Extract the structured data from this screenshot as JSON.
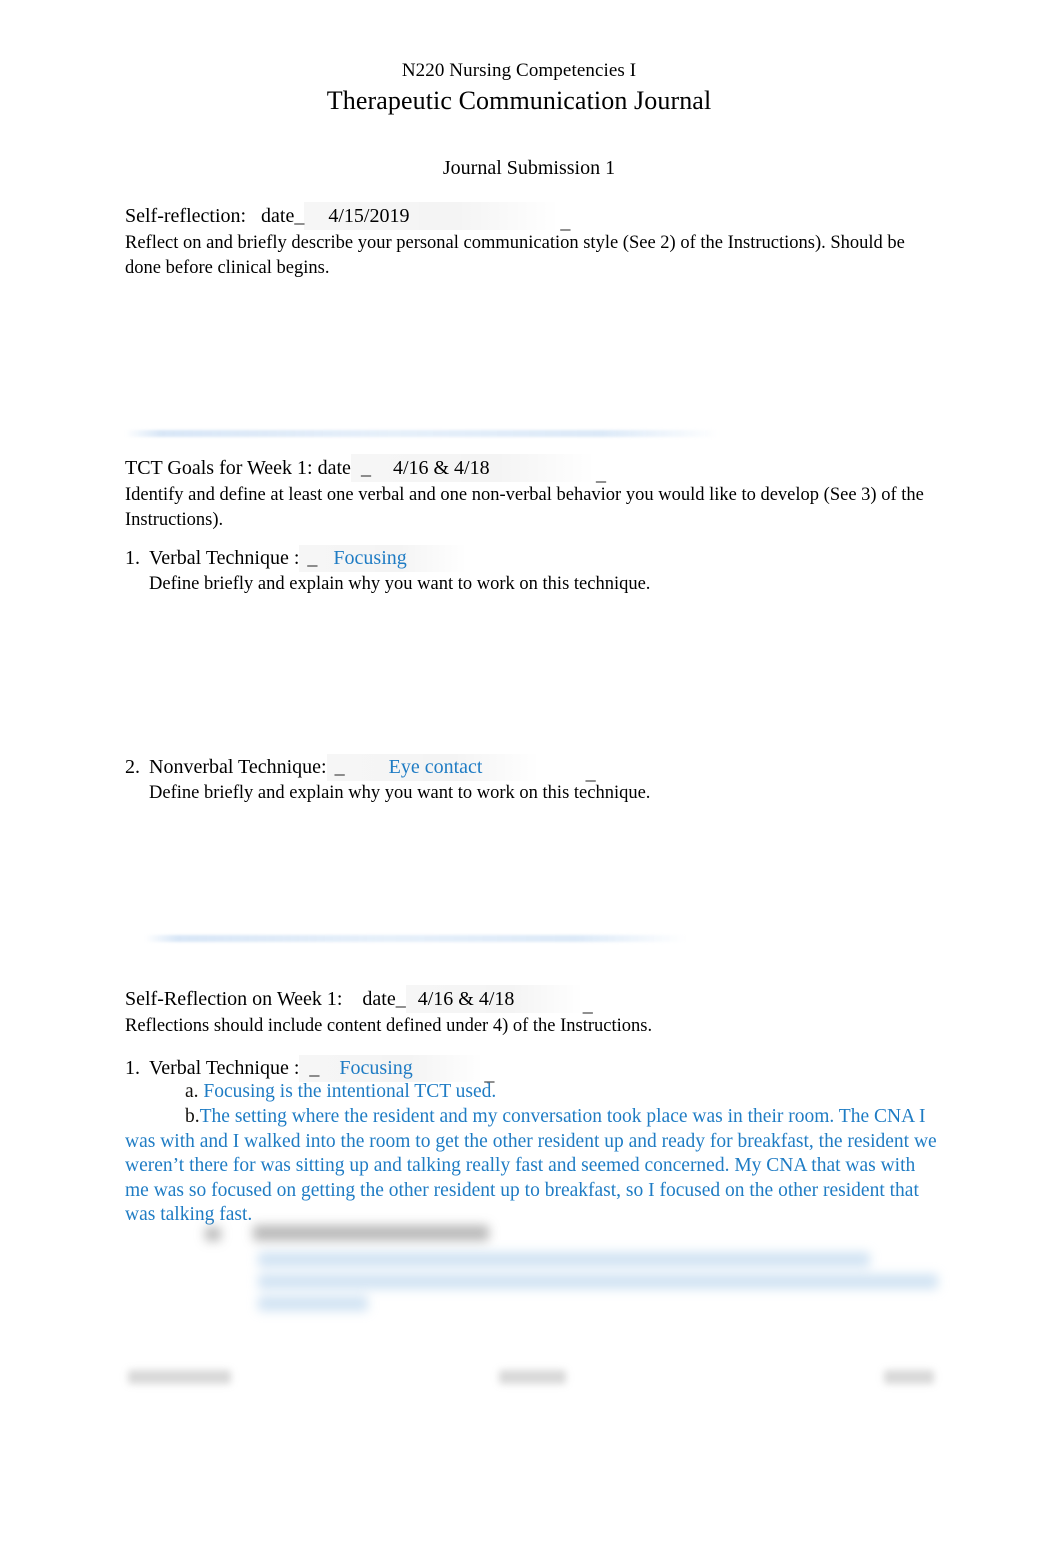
{
  "document": {
    "course": "N220 Nursing Competencies I",
    "title": "Therapeutic Communication Journal",
    "submission": "Journal Submission 1"
  },
  "self_reflection": {
    "label": "Self-reflection:   date",
    "tick_open": "_",
    "date_value": "4/15/2019",
    "tick_close": "_",
    "instruction": "Reflect on and briefly describe your personal communication style (See 2) of the Instructions).  Should be done before clinical begins."
  },
  "tct_goals": {
    "label": "TCT Goals for Week 1: date",
    "tick_open": "_",
    "date_value": "4/16 & 4/18",
    "tick_close": "_",
    "instruction": "Identify and define at least one verbal and one non-verbal behavior you would like to develop (See 3) of the Instructions).",
    "items": [
      {
        "marker": "1.",
        "label": "Verbal Technique :",
        "tick_open": "_",
        "value": "Focusing",
        "tick_close": "",
        "sub_instruction": "Define briefly and explain why you want to work on this technique."
      },
      {
        "marker": "2.",
        "label": "Nonverbal Technique:",
        "tick_open": "_",
        "value": "Eye contact",
        "tick_close": "_",
        "sub_instruction": "Define briefly and explain why you want to work on this technique."
      }
    ]
  },
  "week_reflection": {
    "label": "Self-Reflection on Week 1:    date",
    "tick_open": "_",
    "date_value": "4/16 & 4/18",
    "tick_close": "_",
    "instruction": "Reflections should include content defined under 4) of the Instructions.",
    "item": {
      "marker": "1.",
      "label": "Verbal Technique :",
      "tick_open": "_",
      "value": "Focusing",
      "tick_close": "_"
    },
    "sub_items": [
      {
        "marker": "a.",
        "text": "Focusing is the intentional TCT used."
      },
      {
        "marker": "b.",
        "text": "The setting where the resident and my conversation took place was in their room. The CNA I was with and I walked into the room to get the other resident up and ready for breakfast, the resident we weren’t there for was sitting up and talking really fast and seemed concerned. My CNA that was with me was so focused on getting the other resident up to breakfast, so I focused on the other resident that was talking fast."
      }
    ]
  },
  "colors": {
    "blue_text": "#1f7cc4",
    "body_text": "#000000",
    "divider": "#dbe9f7"
  }
}
